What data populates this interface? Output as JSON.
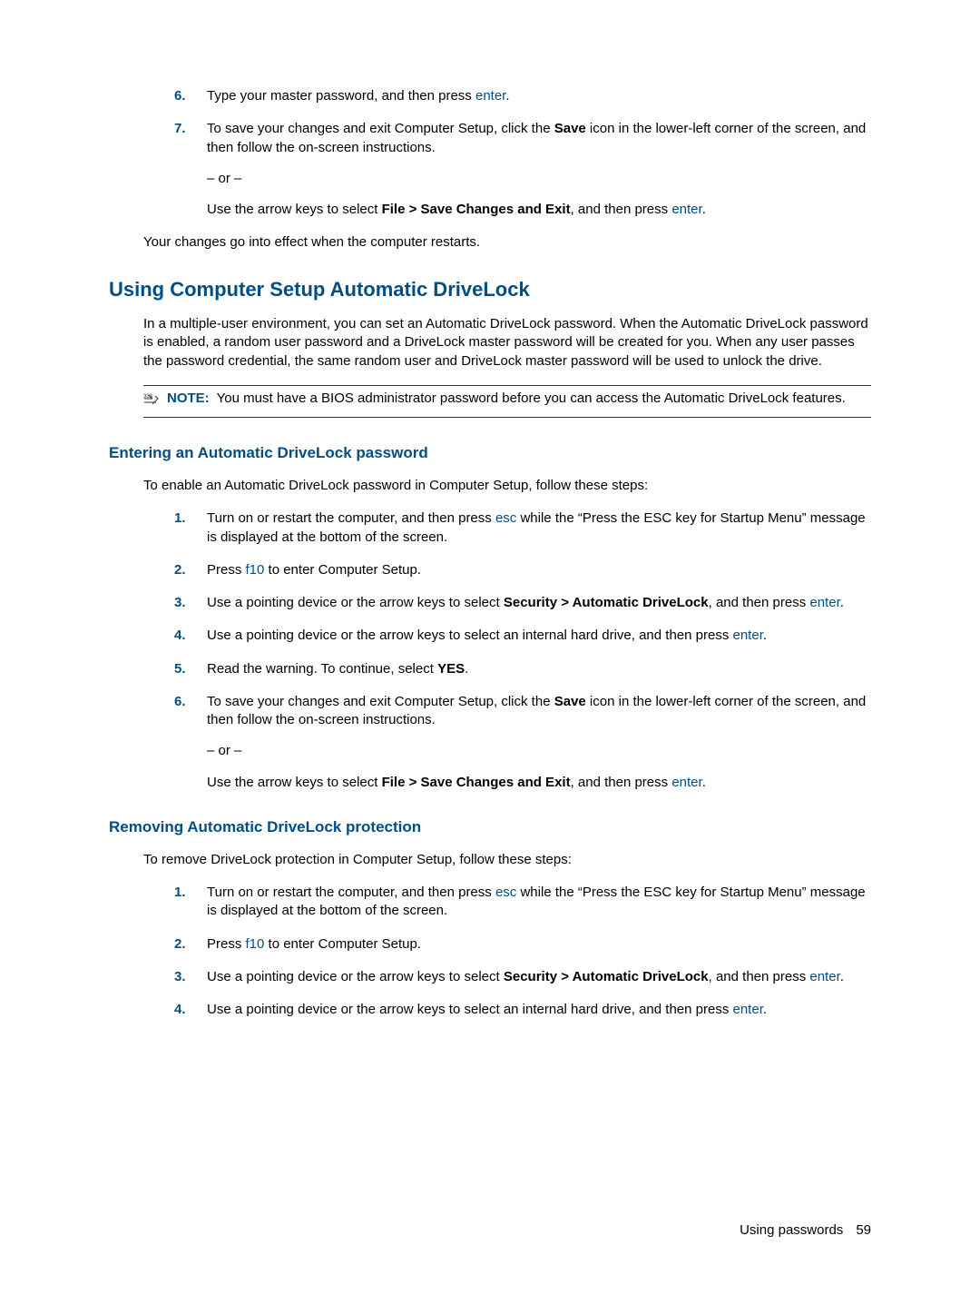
{
  "top_steps": {
    "s6": {
      "num": "6.",
      "text_before": "Type your master password, and then press ",
      "key": "enter",
      "text_after": "."
    },
    "s7": {
      "num": "7.",
      "line1_a": "To save your changes and exit Computer Setup, click the ",
      "line1_bold": "Save",
      "line1_b": " icon in the lower-left corner of the screen, and then follow the on-screen instructions.",
      "or": "– or –",
      "line2_a": "Use the arrow keys to select ",
      "line2_bold": "File > Save Changes and Exit",
      "line2_b": ", and then press ",
      "line2_key": "enter",
      "line2_c": "."
    },
    "after": "Your changes go into effect when the computer restarts."
  },
  "h1": "Using Computer Setup Automatic DriveLock",
  "intro1": "In a multiple-user environment, you can set an Automatic DriveLock password. When the Automatic DriveLock password is enabled, a random user password and a DriveLock master password will be created for you. When any user passes the password credential, the same random user and DriveLock master password will be used to unlock the drive.",
  "note": {
    "label": "NOTE:",
    "text": "You must have a BIOS administrator password before you can access the Automatic DriveLock features."
  },
  "sec_enter": {
    "title": "Entering an Automatic DriveLock password",
    "intro": "To enable an Automatic DriveLock password in Computer Setup, follow these steps:",
    "s1": {
      "num": "1.",
      "a": "Turn on or restart the computer, and then press ",
      "key": "esc",
      "b": " while the “Press the ESC key for Startup Menu” message is displayed at the bottom of the screen."
    },
    "s2": {
      "num": "2.",
      "a": "Press ",
      "key": "f10",
      "b": " to enter Computer Setup."
    },
    "s3": {
      "num": "3.",
      "a": "Use a pointing device or the arrow keys to select ",
      "bold": "Security > Automatic DriveLock",
      "b": ", and then press ",
      "key": "enter",
      "c": "."
    },
    "s4": {
      "num": "4.",
      "a": "Use a pointing device or the arrow keys to select an internal hard drive, and then press ",
      "key": "enter",
      "b": "."
    },
    "s5": {
      "num": "5.",
      "a": "Read the warning. To continue, select ",
      "bold": "YES",
      "b": "."
    },
    "s6": {
      "num": "6.",
      "line1_a": "To save your changes and exit Computer Setup, click the ",
      "line1_bold": "Save",
      "line1_b": " icon in the lower-left corner of the screen, and then follow the on-screen instructions.",
      "or": "– or –",
      "line2_a": "Use the arrow keys to select ",
      "line2_bold": "File > Save Changes and Exit",
      "line2_b": ", and then press ",
      "line2_key": "enter",
      "line2_c": "."
    }
  },
  "sec_remove": {
    "title": "Removing Automatic DriveLock protection",
    "intro": "To remove DriveLock protection in Computer Setup, follow these steps:",
    "s1": {
      "num": "1.",
      "a": "Turn on or restart the computer, and then press ",
      "key": "esc",
      "b": " while the “Press the ESC key for Startup Menu” message is displayed at the bottom of the screen."
    },
    "s2": {
      "num": "2.",
      "a": "Press ",
      "key": "f10",
      "b": " to enter Computer Setup."
    },
    "s3": {
      "num": "3.",
      "a": "Use a pointing device or the arrow keys to select ",
      "bold": "Security > Automatic DriveLock",
      "b": ", and then press ",
      "key": "enter",
      "c": "."
    },
    "s4": {
      "num": "4.",
      "a": "Use a pointing device or the arrow keys to select an internal hard drive, and then press ",
      "key": "enter",
      "b": "."
    }
  },
  "footer": {
    "section": "Using passwords",
    "page": "59"
  }
}
